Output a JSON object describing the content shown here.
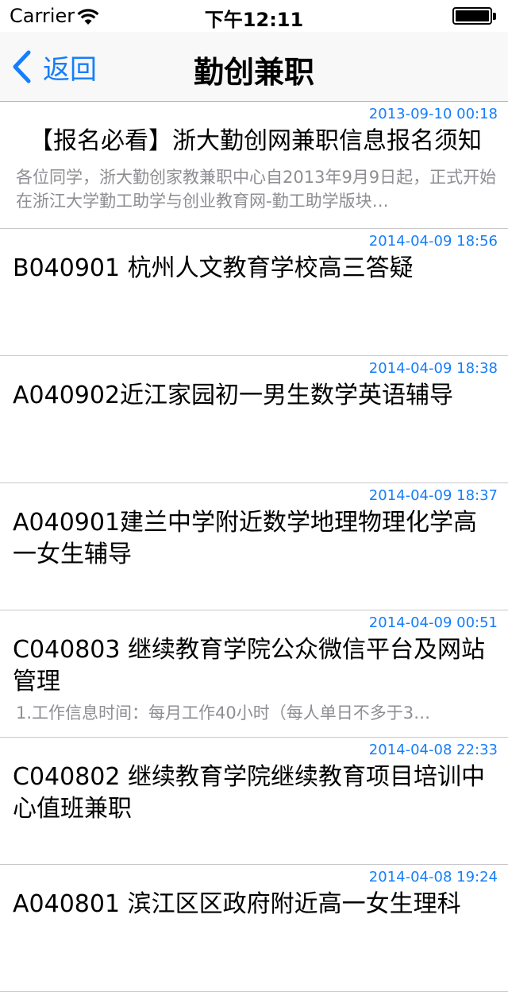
{
  "status_bar": {
    "carrier": "Carrier",
    "time": "下午12:11",
    "wifi_icon": "wifi-icon",
    "battery_icon": "battery-icon"
  },
  "nav": {
    "back_label": "返回",
    "back_icon": "chevron-left-icon",
    "title": "勤创兼职",
    "accent_color": "#157efb"
  },
  "items": [
    {
      "date": "2013-09-10 00:18",
      "title": "【报名必看】浙大勤创网兼职信息报名须知",
      "summary": "各位同学，浙大勤创家教兼职中心自2013年9月9日起，正式开始在浙江大学勤工助学与创业教育网-勤工助学版块…"
    },
    {
      "date": "2014-04-09 18:56",
      "title": "B040901 杭州人文教育学校高三答疑",
      "summary": ""
    },
    {
      "date": "2014-04-09 18:38",
      "title": "A040902近江家园初一男生数学英语辅导",
      "summary": ""
    },
    {
      "date": "2014-04-09 18:37",
      "title": "A040901建兰中学附近数学地理物理化学高一女生辅导",
      "summary": ""
    },
    {
      "date": "2014-04-09 00:51",
      "title": "C040803 继续教育学院公众微信平台及网站管理",
      "summary": "1.工作信息时间：每月工作40小时（每人单日不多于3…"
    },
    {
      "date": "2014-04-08 22:33",
      "title": "C040802 继续教育学院继续教育项目培训中心值班兼职",
      "summary": ""
    },
    {
      "date": "2014-04-08 19:24",
      "title": "A040801 滨江区区政府附近高一女生理科",
      "summary": ""
    }
  ]
}
